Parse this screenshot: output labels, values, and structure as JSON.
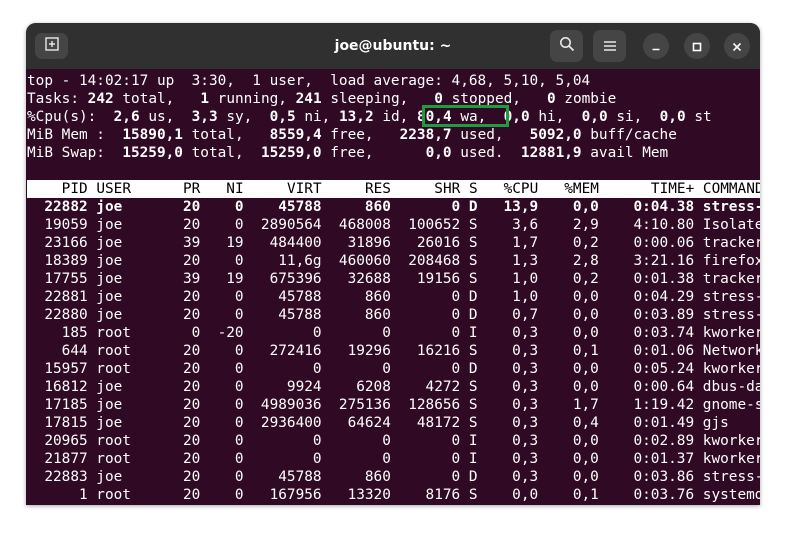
{
  "window": {
    "title": "joe@ubuntu: ~",
    "new_tab_icon": "new-tab-icon",
    "search_icon": "search-icon",
    "menu_icon": "hamburger-menu-icon",
    "minimize_icon": "minimize-icon",
    "maximize_icon": "maximize-icon",
    "close_icon": "close-icon"
  },
  "summary": {
    "line1": "top - 14:02:17 up  3:30,  1 user,  load average: 4,68, 5,10, 5,04",
    "tasks": {
      "label": "Tasks:",
      "total": "242",
      "total_lbl": "total,",
      "running": "1",
      "running_lbl": "running,",
      "sleeping": "241",
      "sleeping_lbl": "sleeping,",
      "stopped": "0",
      "stopped_lbl": "stopped,",
      "zombie": "0",
      "zombie_lbl": "zombie"
    },
    "cpu": {
      "label": "%Cpu(s):",
      "us": "2,6",
      "us_lbl": "us,",
      "sy": "3,3",
      "sy_lbl": "sy,",
      "ni": "0,5",
      "ni_lbl": "ni,",
      "id": "13,2",
      "id_lbl": "id,",
      "wa": "80,4",
      "wa_lbl": "wa,",
      "hi": "0,0",
      "hi_lbl": "hi,",
      "si": "0,0",
      "si_lbl": "si,",
      "st": "0,0",
      "st_lbl": "st"
    },
    "mem": {
      "label": "MiB Mem :",
      "total": "15890,1",
      "total_lbl": "total,",
      "free": "8559,4",
      "free_lbl": "free,",
      "used": "2238,7",
      "used_lbl": "used,",
      "buff": "5092,0",
      "buff_lbl": "buff/cache"
    },
    "swap": {
      "label": "MiB Swap:",
      "total": "15259,0",
      "total_lbl": "total,",
      "free": "15259,0",
      "free_lbl": "free,",
      "used": "0,0",
      "used_lbl": "used.",
      "avail": "12881,9",
      "avail_lbl": "avail Mem"
    }
  },
  "table": {
    "columns": [
      "PID",
      "USER",
      "PR",
      "NI",
      "VIRT",
      "RES",
      "SHR",
      "S",
      "%CPU",
      "%MEM",
      "TIME+",
      "COMMAND"
    ],
    "rows": [
      [
        "22882",
        "joe",
        "20",
        "0",
        "45788",
        "860",
        "0",
        "D",
        "13,9",
        "0,0",
        "0:04.38",
        "stress-+"
      ],
      [
        "19059",
        "joe",
        "20",
        "0",
        "2890564",
        "468008",
        "100652",
        "S",
        "3,6",
        "2,9",
        "4:10.80",
        "Isolate+"
      ],
      [
        "23166",
        "joe",
        "39",
        "19",
        "484400",
        "31896",
        "26016",
        "S",
        "1,7",
        "0,2",
        "0:00.06",
        "tracker+"
      ],
      [
        "18389",
        "joe",
        "20",
        "0",
        "11,6g",
        "460060",
        "208468",
        "S",
        "1,3",
        "2,8",
        "3:21.16",
        "firefox"
      ],
      [
        "17755",
        "joe",
        "39",
        "19",
        "675396",
        "32688",
        "19156",
        "S",
        "1,0",
        "0,2",
        "0:01.38",
        "tracker+"
      ],
      [
        "22881",
        "joe",
        "20",
        "0",
        "45788",
        "860",
        "0",
        "D",
        "1,0",
        "0,0",
        "0:04.29",
        "stress-+"
      ],
      [
        "22880",
        "joe",
        "20",
        "0",
        "45788",
        "860",
        "0",
        "D",
        "0,7",
        "0,0",
        "0:03.89",
        "stress-+"
      ],
      [
        "185",
        "root",
        "0",
        "-20",
        "0",
        "0",
        "0",
        "I",
        "0,3",
        "0,0",
        "0:03.74",
        "kworker+"
      ],
      [
        "644",
        "root",
        "20",
        "0",
        "272416",
        "19296",
        "16216",
        "S",
        "0,3",
        "0,1",
        "0:01.06",
        "Network+"
      ],
      [
        "15957",
        "root",
        "20",
        "0",
        "0",
        "0",
        "0",
        "D",
        "0,3",
        "0,0",
        "0:05.24",
        "kworker+"
      ],
      [
        "16812",
        "joe",
        "20",
        "0",
        "9924",
        "6208",
        "4272",
        "S",
        "0,3",
        "0,0",
        "0:00.64",
        "dbus-da+"
      ],
      [
        "17185",
        "joe",
        "20",
        "0",
        "4989036",
        "275136",
        "128656",
        "S",
        "0,3",
        "1,7",
        "1:19.42",
        "gnome-s+"
      ],
      [
        "17815",
        "joe",
        "20",
        "0",
        "2936400",
        "64624",
        "48172",
        "S",
        "0,3",
        "0,4",
        "0:01.49",
        "gjs"
      ],
      [
        "20965",
        "root",
        "20",
        "0",
        "0",
        "0",
        "0",
        "I",
        "0,3",
        "0,0",
        "0:02.89",
        "kworker+"
      ],
      [
        "21877",
        "root",
        "20",
        "0",
        "0",
        "0",
        "0",
        "I",
        "0,3",
        "0,0",
        "0:01.37",
        "kworker+"
      ],
      [
        "22883",
        "joe",
        "20",
        "0",
        "45788",
        "860",
        "0",
        "D",
        "0,3",
        "0,0",
        "0:03.86",
        "stress-+"
      ],
      [
        "1",
        "root",
        "20",
        "0",
        "167956",
        "13320",
        "8176",
        "S",
        "0,0",
        "0,1",
        "0:03.76",
        "systemd"
      ]
    ]
  }
}
